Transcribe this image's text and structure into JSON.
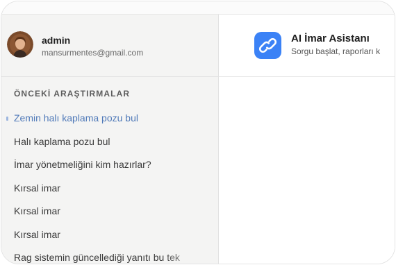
{
  "user": {
    "name": "admin",
    "email": "mansurmentes@gmail.com"
  },
  "sidebar": {
    "section_title": "ÖNCEKİ ARAŞTIRMALAR",
    "items": [
      {
        "label": "Zemin halı kaplama pozu bul",
        "active": true
      },
      {
        "label": "Halı kaplama pozu bul"
      },
      {
        "label": "İmar yönetmeliğini kim hazırlar?"
      },
      {
        "label": "Kırsal imar"
      },
      {
        "label": "Kırsal imar"
      },
      {
        "label": "Kırsal imar"
      },
      {
        "label": "Rag sistemin güncellediği yanıtı bu tek"
      }
    ]
  },
  "header": {
    "title": "AI İmar Asistanı",
    "subtitle": "Sorgu başlat, raporları k",
    "icon": "link-icon"
  },
  "colors": {
    "accent": "#3b82f6",
    "active_item": "#4f79b8"
  }
}
